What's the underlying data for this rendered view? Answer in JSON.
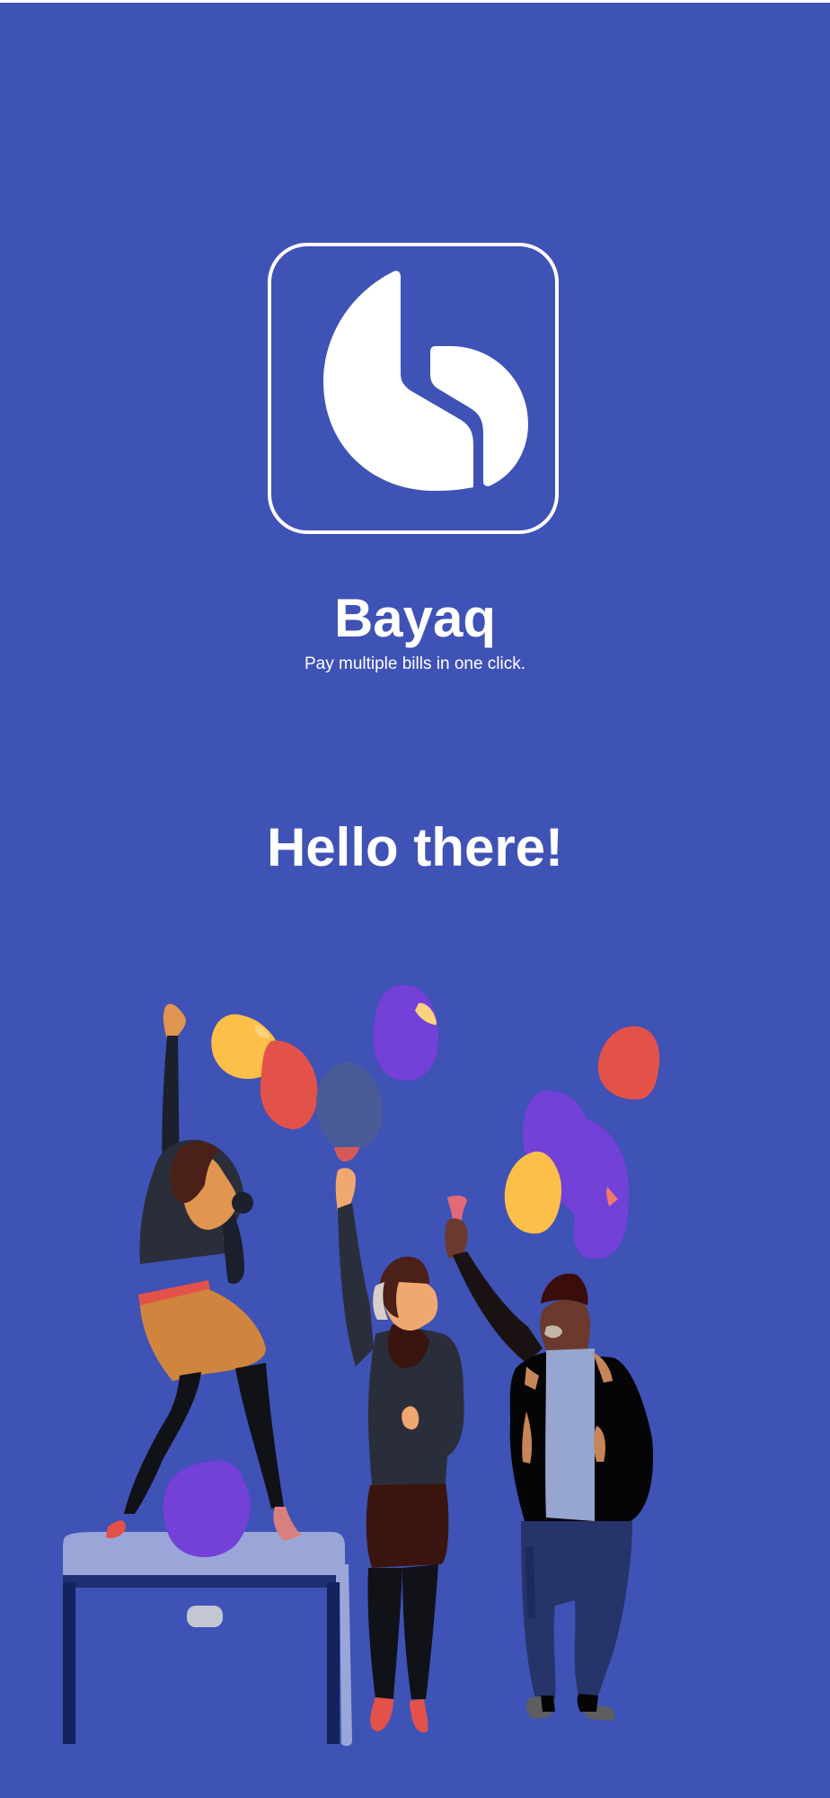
{
  "app": {
    "name": "Bayaq",
    "tagline": "Pay multiple bills in one click."
  },
  "welcome": {
    "greeting": "Hello there!"
  },
  "icons": {
    "logo": "bayaq-logo-icon",
    "illustration": "celebration-people-balloons-illustration"
  },
  "colors": {
    "background": "#3f52b5",
    "text": "#ffffff"
  }
}
